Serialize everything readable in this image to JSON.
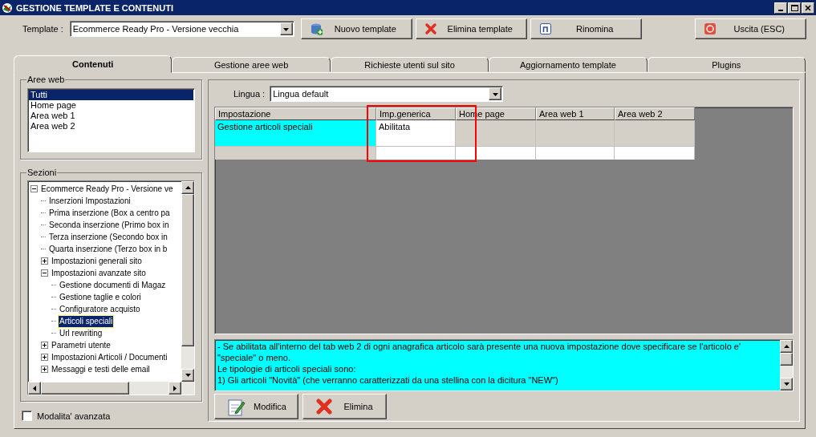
{
  "window": {
    "title": "GESTIONE TEMPLATE E CONTENUTI"
  },
  "template": {
    "label": "Template :",
    "value": "Ecommerce Ready Pro - Versione vecchia"
  },
  "toolbar": [
    {
      "kind": "new",
      "label": "Nuovo template"
    },
    {
      "kind": "delete",
      "label": "Elimina template"
    },
    {
      "kind": "rename",
      "label": "Rinomina"
    },
    {
      "kind": "exit",
      "label": "Uscita (ESC)"
    }
  ],
  "tabs": [
    {
      "label": "Contenuti",
      "selected": true
    },
    {
      "label": "Gestione aree web",
      "selected": false
    },
    {
      "label": "Richieste utenti sul sito",
      "selected": false
    },
    {
      "label": "Aggiornamento template",
      "selected": false
    },
    {
      "label": "Plugins",
      "selected": false
    }
  ],
  "web_areas": {
    "title": "Aree web",
    "items": [
      {
        "label": "Tutti",
        "selected": true
      },
      {
        "label": "Home page",
        "selected": false
      },
      {
        "label": "Area web 1",
        "selected": false
      },
      {
        "label": "Area web 2",
        "selected": false
      }
    ]
  },
  "sections": {
    "title": "Sezioni",
    "tree": [
      {
        "label": "Ecommerce Ready Pro - Versione ve",
        "expanded": true,
        "selected": false,
        "children": [
          {
            "label": "Inserzioni Impostazioni",
            "selected": false
          },
          {
            "label": "Prima inserzione (Box a centro pa",
            "selected": false
          },
          {
            "label": "Seconda inserzione (Primo box in",
            "selected": false
          },
          {
            "label": "Terza inserzione (Secondo box in",
            "selected": false
          },
          {
            "label": "Quarta inserzione (Terzo box in b",
            "selected": false
          },
          {
            "label": "Impostazioni generali sito",
            "expanded": false,
            "selected": false
          },
          {
            "label": "Impostazioni avanzate sito",
            "expanded": true,
            "selected": false,
            "children": [
              {
                "label": "Gestione documenti di Magaz",
                "selected": false
              },
              {
                "label": "Gestione taglie e colori",
                "selected": false
              },
              {
                "label": "Configuratore acquisto",
                "selected": false
              },
              {
                "label": "Articoli speciali",
                "selected": true
              },
              {
                "label": "Url rewriting",
                "selected": false
              }
            ]
          },
          {
            "label": "Parametri utente",
            "expanded": false,
            "selected": false
          },
          {
            "label": "Impostazioni Articoli / Documenti",
            "expanded": false,
            "selected": false
          },
          {
            "label": "Messaggi e testi delle email",
            "expanded": false,
            "selected": false
          }
        ]
      }
    ]
  },
  "advanced_mode": {
    "label": "Modalita' avanzata",
    "checked": false
  },
  "language": {
    "label": "Lingua :",
    "value": "Lingua default"
  },
  "grid": {
    "columns": [
      "Impostazione",
      "Imp.generica",
      "Home page",
      "Area web 1",
      "Area web 2"
    ],
    "rows": [
      {
        "selected": true,
        "cells": [
          "Gestione articoli speciali",
          "Abilitata"
        ]
      }
    ]
  },
  "description": [
    "- Se abilitata all'interno del tab web 2 di ogni anagrafica articolo sarà presente una nuova impostazione dove specificare se l'articolo e' \"speciale\" o meno.",
    "Le tipologie di articoli speciali sono:",
    "1) Gli articoli \"Novità\" (che verranno caratterizzati da una stellina con la dicitura \"NEW\")"
  ],
  "actions": [
    {
      "kind": "edit",
      "label": "Modifica"
    },
    {
      "kind": "delete",
      "label": "Elimina"
    }
  ]
}
